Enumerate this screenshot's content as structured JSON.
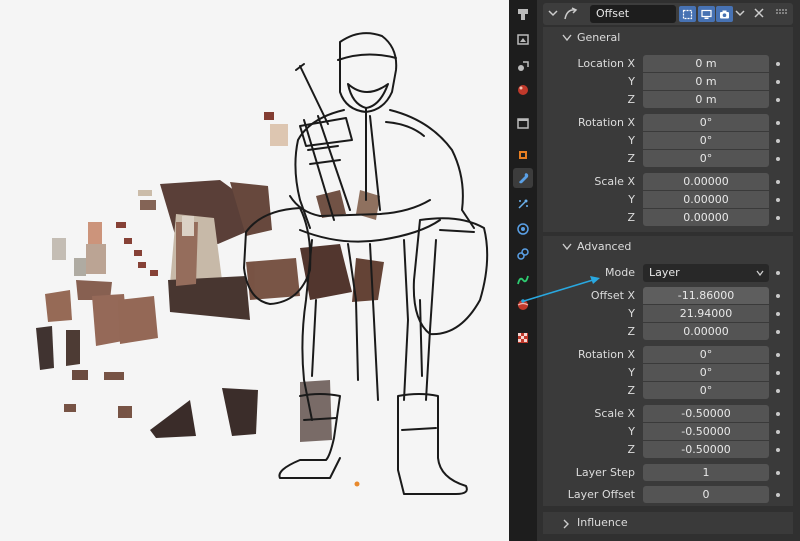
{
  "modifier": {
    "name": "Offset"
  },
  "general": {
    "title": "General",
    "location_label": "Location X",
    "location": [
      "0 m",
      "0 m",
      "0 m"
    ],
    "rotation_label": "Rotation X",
    "rotation": [
      "0°",
      "0°",
      "0°"
    ],
    "scale_label": "Scale X",
    "scale": [
      "0.00000",
      "0.00000",
      "0.00000"
    ],
    "y_label": "Y",
    "z_label": "Z"
  },
  "advanced": {
    "title": "Advanced",
    "mode_label": "Mode",
    "mode_value": "Layer",
    "offset_label": "Offset X",
    "offset": [
      "-11.86000",
      "21.94000",
      "0.00000"
    ],
    "rotation_label": "Rotation X",
    "rotation": [
      "0°",
      "0°",
      "0°"
    ],
    "scale_label": "Scale X",
    "scale": [
      "-0.50000",
      "-0.50000",
      "-0.50000"
    ],
    "layer_step_label": "Layer Step",
    "layer_step": "1",
    "layer_offset_label": "Layer Offset",
    "layer_offset": "0",
    "y_label": "Y",
    "z_label": "Z"
  },
  "influence": {
    "title": "Influence"
  },
  "colors": {
    "accent": "#4772b3",
    "arrow": "#29a8e0",
    "panel_bg": "#303030",
    "field_bg": "#545454"
  },
  "icons": [
    "tool-icon",
    "render-icon",
    "output-icon",
    "view-layer-icon",
    "scene-icon",
    "world-icon",
    "collection-icon",
    "object-icon",
    "modifier-wrench-icon",
    "particles-icon",
    "physics-icon",
    "constraints-icon",
    "data-icon",
    "material-icon",
    "texture-icon"
  ]
}
